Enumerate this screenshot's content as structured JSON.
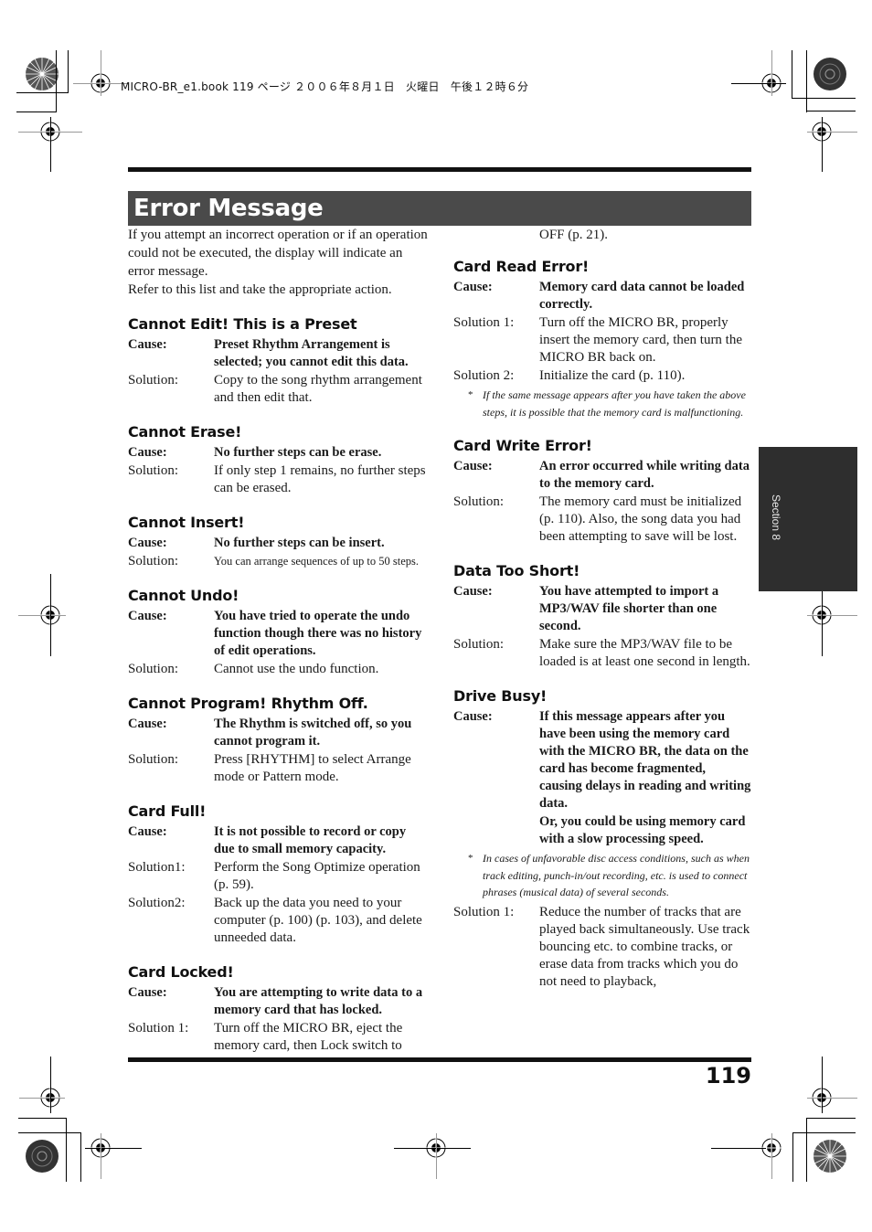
{
  "slug": "MICRO-BR_e1.book  119 ページ  ２００６年８月１日　火曜日　午後１２時６分",
  "title": "Error Message",
  "intro": [
    "If you attempt an incorrect operation or if an operation could not be executed, the display will indicate an error message.",
    "Refer to this list and take the appropriate action."
  ],
  "section_tab": "Section 8",
  "page_number": "119",
  "left_entries": [
    {
      "heading": "Cannot Edit! This is a Preset",
      "rows": [
        {
          "label": "Cause:",
          "text": "Preset Rhythm Arrangement is selected; you cannot edit this data."
        },
        {
          "label": "Solution:",
          "text": "Copy to the song rhythm arrangement and then edit that."
        }
      ]
    },
    {
      "heading": "Cannot Erase!",
      "rows": [
        {
          "label": "Cause:",
          "text": "No further steps can be erase."
        },
        {
          "label": "Solution:",
          "text": "If only step 1 remains, no further steps can be erased."
        }
      ]
    },
    {
      "heading": "Cannot Insert!",
      "rows": [
        {
          "label": "Cause:",
          "text": "No further steps can be insert."
        },
        {
          "label": "Solution:",
          "text": "You can arrange sequences of up to 50 steps."
        }
      ]
    },
    {
      "heading": "Cannot Undo!",
      "rows": [
        {
          "label": "Cause:",
          "text": "You have tried to operate the undo function though there was no history of edit operations."
        },
        {
          "label": "Solution:",
          "text": "Cannot use the undo function."
        }
      ]
    },
    {
      "heading": "Cannot Program! Rhythm Off.",
      "rows": [
        {
          "label": "Cause:",
          "text": "The Rhythm is switched off, so you cannot program it."
        },
        {
          "label": "Solution:",
          "text": "Press [RHYTHM] to select Arrange mode or Pattern mode."
        }
      ]
    },
    {
      "heading": "Card Full!",
      "rows": [
        {
          "label": "Cause:",
          "text": "It is not possible to record or copy due to small memory capacity."
        },
        {
          "label": "Solution1:",
          "text": "Perform the Song Optimize operation (p. 59)."
        },
        {
          "label": "Solution2:",
          "text": "Back up the data you need to your computer (p. 100) (p. 103), and delete unneeded data."
        }
      ]
    },
    {
      "heading": "Card Locked!",
      "rows": [
        {
          "label": "Cause:",
          "text": "You are attempting to write data to a memory card that has locked."
        },
        {
          "label": "Solution 1:",
          "text": "Turn off the MICRO BR, eject the memory card, then Lock switch to"
        }
      ]
    }
  ],
  "right_continuation": "OFF (p. 21).",
  "right_entries": [
    {
      "heading": "Card Read Error!",
      "rows": [
        {
          "label": "Cause:",
          "text": "Memory card data cannot be loaded correctly."
        },
        {
          "label": "Solution 1:",
          "text": "Turn off the MICRO BR, properly insert the memory card, then turn the MICRO BR back on."
        },
        {
          "label": "Solution 2:",
          "text": "Initialize the card (p. 110)."
        }
      ],
      "note": "If the same message appears after you have taken the above steps, it is possible that the memory card is malfunctioning."
    },
    {
      "heading": "Card Write Error!",
      "rows": [
        {
          "label": "Cause:",
          "text": "An error occurred while writing data to the memory card."
        },
        {
          "label": "Solution:",
          "text": "The memory card must be initialized (p. 110). Also, the song data you had been attempting to save will be lost."
        }
      ]
    },
    {
      "heading": "Data Too Short!",
      "rows": [
        {
          "label": "Cause:",
          "text": "You have attempted to import a MP3/WAV file shorter than one second."
        },
        {
          "label": "Solution:",
          "text": "Make sure the MP3/WAV file to be loaded is at least one second in length."
        }
      ]
    },
    {
      "heading": "Drive Busy!",
      "rows": [
        {
          "label": "Cause:",
          "text": "If this message appears after you have been using the memory card with the MICRO BR, the data on the card has become fragmented, causing delays in reading and writing data."
        },
        {
          "label": "",
          "text": "Or, you could be using memory card with a slow processing speed."
        }
      ],
      "note": "In cases of unfavorable disc access conditions, such as when track editing, punch-in/out recording, etc. is used to connect phrases (musical data) of several seconds.",
      "after_note_rows": [
        {
          "label": "Solution 1:",
          "text": "Reduce the number of tracks that are played back simultaneously. Use track bouncing etc. to combine tracks, or erase data from tracks which you do not need to playback,"
        }
      ]
    }
  ],
  "note_marker": "*"
}
